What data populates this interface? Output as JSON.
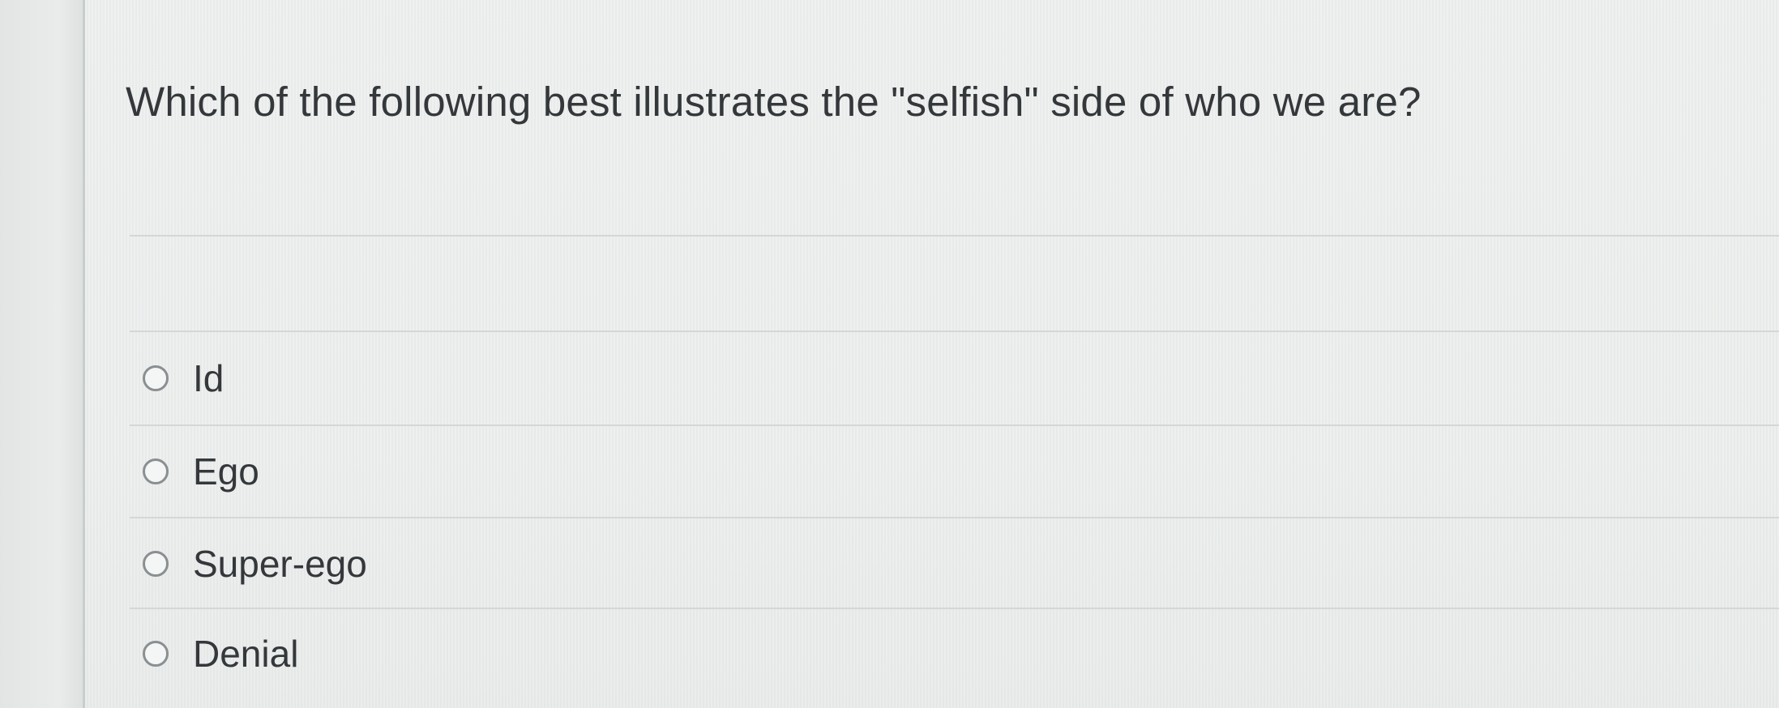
{
  "quiz": {
    "question": "Which of the following best illustrates the \"selfish\" side of who we are?",
    "options": [
      {
        "label": "Id",
        "selected": false
      },
      {
        "label": "Ego",
        "selected": false
      },
      {
        "label": "Super-ego",
        "selected": false
      },
      {
        "label": "Denial",
        "selected": false
      }
    ]
  }
}
